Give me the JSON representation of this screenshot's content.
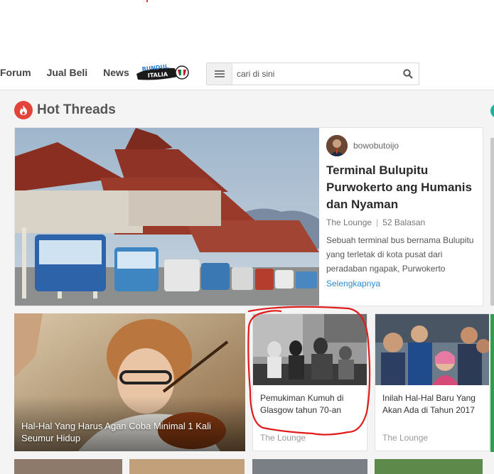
{
  "header": {
    "nav": [
      "Forum",
      "Jual Beli",
      "News"
    ],
    "search_placeholder": "cari di sini",
    "logo_icon": "bundul-italia-logo"
  },
  "section": {
    "title": "Hot Threads",
    "icon": "fire-icon"
  },
  "featured": {
    "author": "bowobutoijo",
    "title": "Terminal Bulupitu Purwokerto ang Humanis dan Nyaman",
    "category": "The Lounge",
    "replies": "52 Balasan",
    "excerpt": "Sebuah terminal bus bernama Bulupitu yang terletak di kota pusat dari peradaban ngapak, Purwokerto",
    "more": "Selengkapnya"
  },
  "cards": [
    {
      "title": "Hal-Hal Yang Harus Agan Coba Minimal 1 Kali Seumur Hidup"
    },
    {
      "title": "Pemukiman Kumuh di Glasgow tahun 70-an",
      "category": "The Lounge"
    },
    {
      "title": "Inilah Hal-Hal Baru Yang Akan Ada di Tahun 2017",
      "category": "The Lounge"
    }
  ],
  "colors": {
    "accent_link": "#2a8dd4",
    "fire": "#e0443a",
    "annotation": "#e01b1b"
  }
}
